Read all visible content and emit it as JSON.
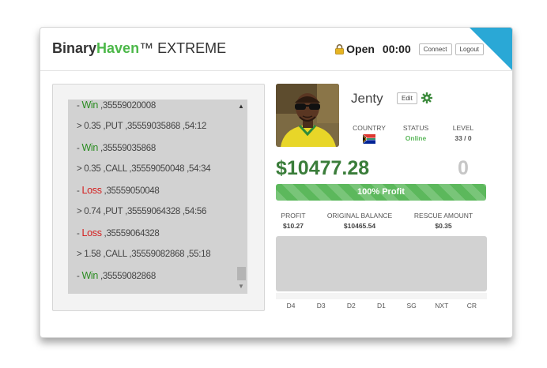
{
  "header": {
    "brand_part1": "Binary",
    "brand_part2": "Haven",
    "brand_part3": "™ EXTREME",
    "status": "Open",
    "timer": "00:00",
    "connect_label": "Connect",
    "logout_label": "Logout"
  },
  "log": {
    "lines": [
      {
        "prefix": "- ",
        "tag": "Win",
        "text": " ,35559020008"
      },
      {
        "prefix": "> 0.35 ,PUT ,35559035868 ,54:12",
        "tag": "",
        "text": ""
      },
      {
        "prefix": "- ",
        "tag": "Win",
        "text": " ,35559035868"
      },
      {
        "prefix": "> 0.35 ,CALL ,35559050048 ,54:34",
        "tag": "",
        "text": ""
      },
      {
        "prefix": "- ",
        "tag": "Loss",
        "text": " ,35559050048"
      },
      {
        "prefix": "> 0.74 ,PUT ,35559064328 ,54:56",
        "tag": "",
        "text": ""
      },
      {
        "prefix": "- ",
        "tag": "Loss",
        "text": " ,35559064328"
      },
      {
        "prefix": "> 1.58 ,CALL ,35559082868 ,55:18",
        "tag": "",
        "text": ""
      },
      {
        "prefix": "- ",
        "tag": "Win",
        "text": " ,35559082868"
      }
    ]
  },
  "profile": {
    "name": "Jenty",
    "edit_label": "Edit",
    "country_label": "COUNTRY",
    "status_label": "STATUS",
    "status_value": "Online",
    "level_label": "LEVEL",
    "level_value": "33 / 0",
    "balance": "$10477.28",
    "counter": "0",
    "progress_percent": 100,
    "progress_label": "100% Profit",
    "profit_label": "PROFIT",
    "profit_value": "$10.27",
    "original_balance_label": "ORIGINAL BALANCE",
    "original_balance_value": "$10465.54",
    "rescue_label": "RESCUE AMOUNT",
    "rescue_value": "$0.35"
  },
  "chart_labels": [
    "D4",
    "D3",
    "D2",
    "D1",
    "SG",
    "NXT",
    "CR"
  ],
  "colors": {
    "brand_green": "#4cb849",
    "win_green": "#2b8c22",
    "loss_red": "#d42020",
    "online_green": "#5cb85c",
    "balance_green": "#3a7d3a",
    "ribbon_blue": "#2aa8d6"
  }
}
